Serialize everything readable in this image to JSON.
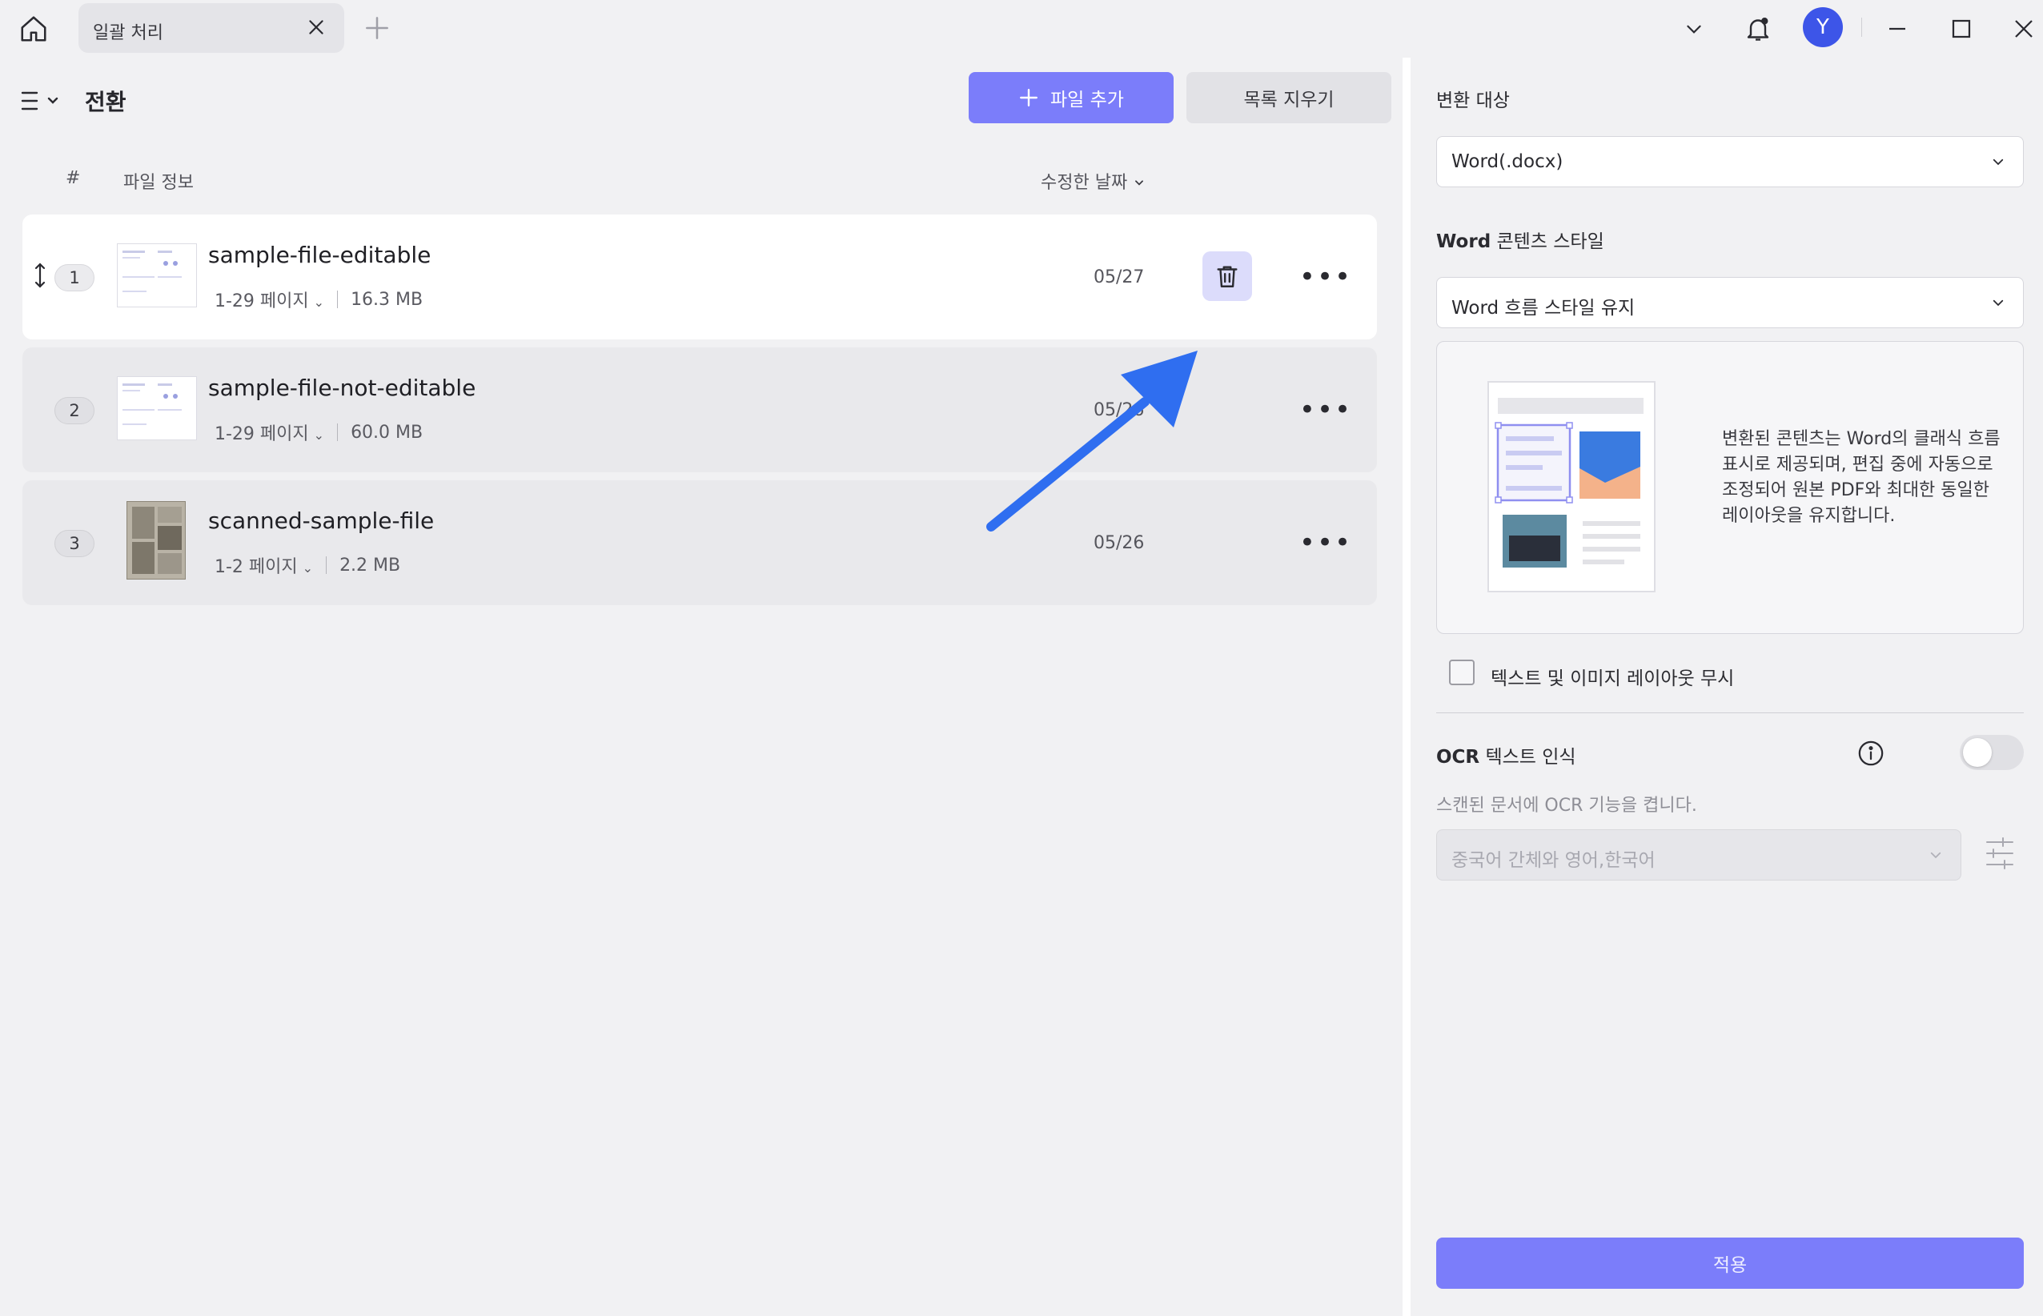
{
  "tab": {
    "title": "일괄 처리"
  },
  "toolbar": {
    "title": "전환",
    "add_files_label": "파일 추가",
    "clear_list_label": "목록 지우기"
  },
  "table": {
    "col_number": "#",
    "col_file_info": "파일 정보",
    "col_modified": "수정한 날짜"
  },
  "files": [
    {
      "index": "1",
      "name": "sample-file-editable",
      "pages": "1-29 페이지",
      "size": "16.3 MB",
      "date": "05/27"
    },
    {
      "index": "2",
      "name": "sample-file-not-editable",
      "pages": "1-29 페이지",
      "size": "60.0 MB",
      "date": "05/26"
    },
    {
      "index": "3",
      "name": "scanned-sample-file",
      "pages": "1-2 페이지",
      "size": "2.2 MB",
      "date": "05/26"
    }
  ],
  "user": {
    "avatar_initial": "Y"
  },
  "settings": {
    "target_label": "변환 대상",
    "target_value": "Word(.docx)",
    "style_label_bold": "Word",
    "style_label_rest": " 콘텐츠 스타일",
    "style_value": "Word 흐름 스타일 유지",
    "style_description": "변환된 콘텐츠는 Word의 클래식 흐름 표시로 제공되며, 편집 중에 자동으로 조정되어 원본 PDF와 최대한 동일한 레이아웃을 유지합니다.",
    "ignore_layout_label": "텍스트 및 이미지 레이아웃 무시",
    "ignore_layout_checked": false,
    "ocr_label_bold": "OCR",
    "ocr_label_rest": " 텍스트 인식",
    "ocr_enabled": false,
    "ocr_subtitle": "스캔된 문서에 OCR 기능을 켭니다.",
    "ocr_language": "중국어 간체와 영어,한국어",
    "apply_label": "적용"
  },
  "colors": {
    "accent": "#7b7dfa",
    "avatar": "#3d55e8",
    "annotation_arrow": "#2f6ef0"
  }
}
